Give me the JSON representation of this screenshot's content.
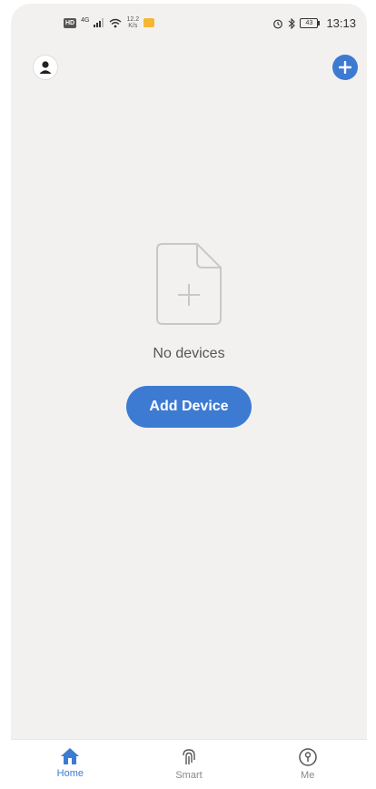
{
  "status_bar": {
    "hd": "HD",
    "network": "4G",
    "speed_value": "12.2",
    "speed_unit": "K/s",
    "battery": "43",
    "time": "13:13"
  },
  "header": {
    "avatar_icon": "person-icon",
    "add_icon": "plus-icon",
    "accent_color": "#3d7bd2"
  },
  "empty_state": {
    "icon": "add-file-icon",
    "message": "No devices",
    "button_label": "Add Device"
  },
  "tabs": [
    {
      "label": "Home",
      "icon": "home-icon",
      "active": true
    },
    {
      "label": "Smart",
      "icon": "fingerprint-icon",
      "active": false
    },
    {
      "label": "Me",
      "icon": "profile-icon",
      "active": false
    }
  ]
}
